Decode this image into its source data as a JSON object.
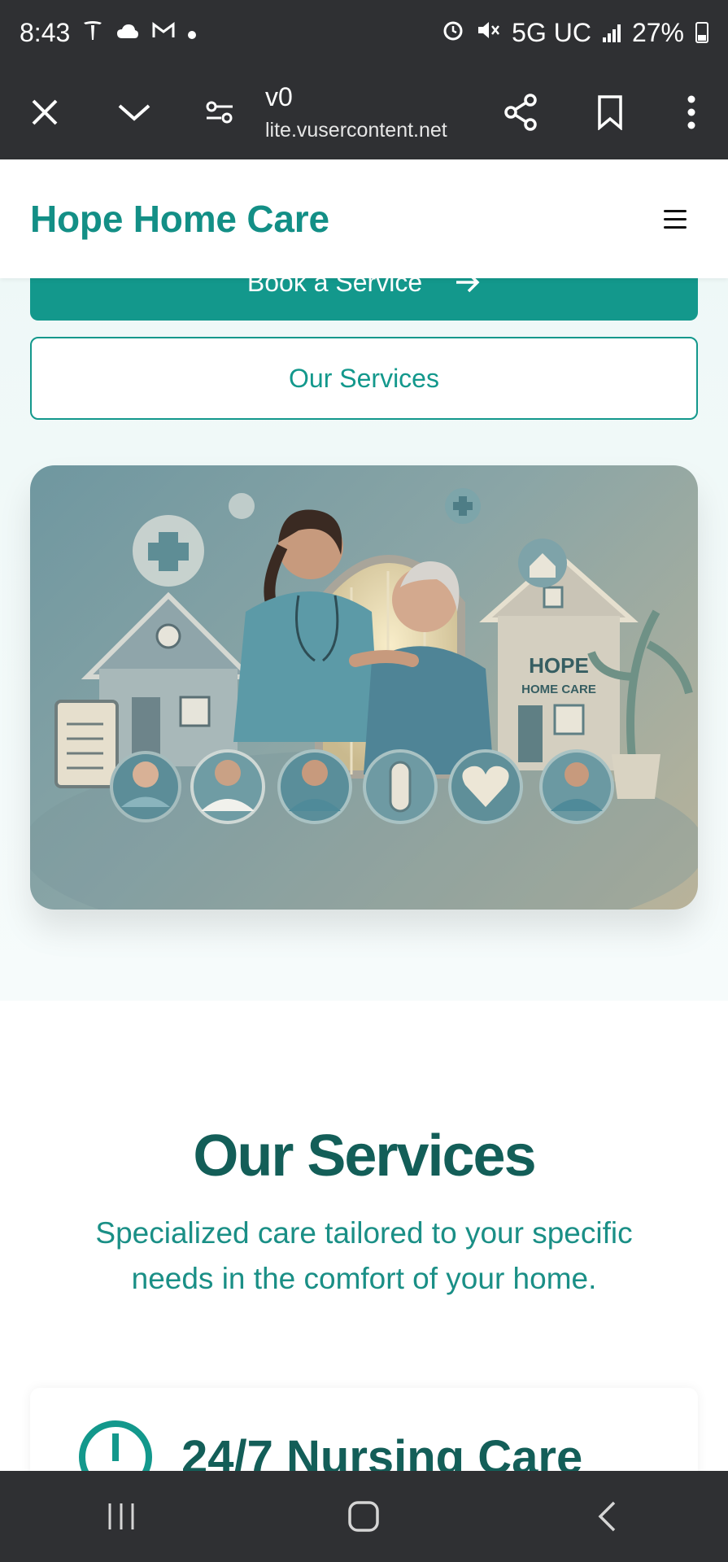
{
  "status_bar": {
    "time": "8:43",
    "network": "5G UC",
    "battery": "27%",
    "notification_icons": [
      "tesla-icon",
      "cloud-icon",
      "gmail-icon",
      "dot-icon"
    ],
    "system_icons": [
      "alarm-icon",
      "mute-icon",
      "signal-icon",
      "battery-icon"
    ]
  },
  "browser": {
    "title": "v0",
    "domain": "lite.vusercontent.net"
  },
  "site": {
    "brand": "Hope Home Care"
  },
  "hero": {
    "primary_button": "Book a Service",
    "secondary_button": "Our Services",
    "image_text_line1": "HOPE",
    "image_text_line2": "HOME CARE"
  },
  "services": {
    "title": "Our Services",
    "subtitle": "Specialized care tailored to your specific needs in the comfort of your home.",
    "card_title": "24/7 Nursing Care"
  },
  "colors": {
    "brand": "#138f86",
    "dark_teal": "#135e58",
    "system_bar": "#2f3033"
  }
}
